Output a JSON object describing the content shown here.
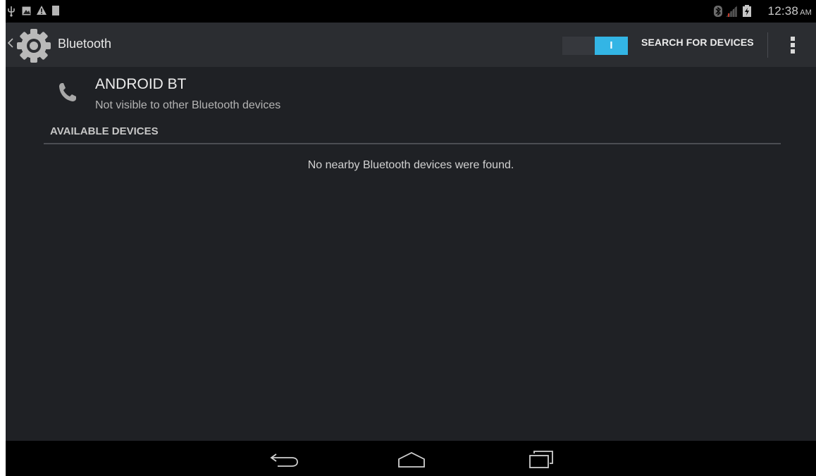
{
  "status_bar": {
    "left_icons": [
      "usb-icon",
      "image-icon",
      "warning-icon",
      "sd-card-icon"
    ],
    "right_icons": [
      "bluetooth-icon",
      "signal-icon",
      "battery-icon"
    ],
    "time": "12:38",
    "ampm": "AM"
  },
  "action_bar": {
    "title": "Bluetooth",
    "toggle_state": "I",
    "search_label": "SEARCH FOR DEVICES"
  },
  "local_device": {
    "name": "ANDROID BT",
    "status": "Not visible to other Bluetooth devices"
  },
  "available": {
    "header": "AVAILABLE DEVICES",
    "empty_message": "No nearby Bluetooth devices were found."
  },
  "nav_bar": {
    "buttons": [
      "back-icon",
      "home-icon",
      "recents-icon"
    ]
  },
  "colors": {
    "background": "#1f2125",
    "action_bar": "#2b2d31",
    "accent": "#33b5e5"
  }
}
